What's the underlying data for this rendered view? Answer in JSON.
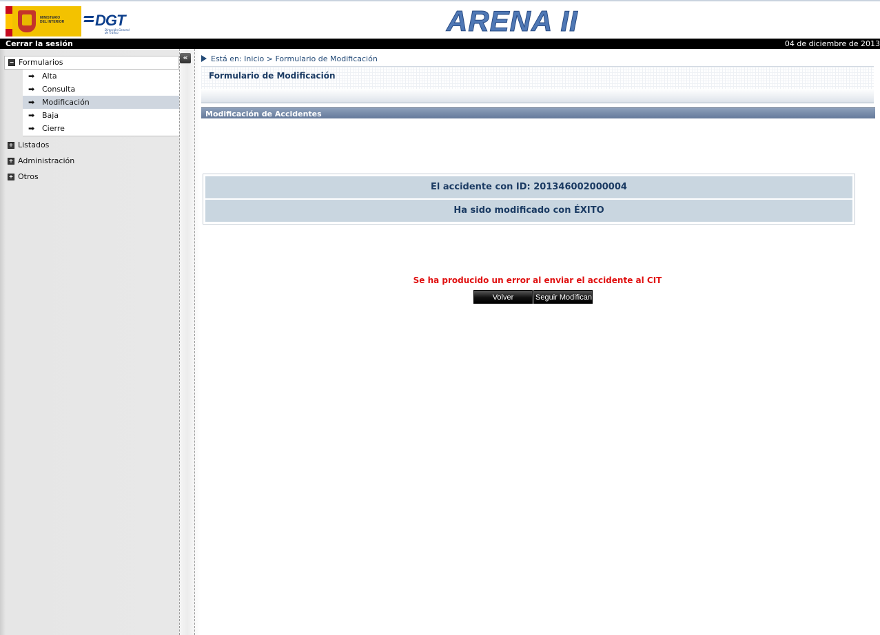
{
  "header": {
    "ministry_text": [
      "MINISTERIO",
      "DEL INTERIOR"
    ],
    "dgt_name": "DGT",
    "dgt_subtitle": [
      "Dirección General",
      "de Tráfico"
    ],
    "app_title": "ARENA II"
  },
  "topbar": {
    "logout_label": "Cerrar la sesión",
    "date": "04 de diciembre de 2013"
  },
  "sidebar": {
    "sections": [
      {
        "label": "Formularios",
        "expanded": true,
        "icon": "collapse-box-icon"
      },
      {
        "label": "Listados",
        "expanded": false,
        "icon": "expand-box-icon"
      },
      {
        "label": "Administración",
        "expanded": false,
        "icon": "expand-box-icon"
      },
      {
        "label": "Otros",
        "expanded": false,
        "icon": "expand-box-icon"
      }
    ],
    "items": [
      {
        "label": "Alta"
      },
      {
        "label": "Consulta"
      },
      {
        "label": "Modificación",
        "active": true
      },
      {
        "label": "Baja"
      },
      {
        "label": "Cierre"
      }
    ],
    "collapse_glyph": "«"
  },
  "main": {
    "breadcrumb": "Está en: Inicio > Formulario de Modificación",
    "form_title": "Formulario de Modificación",
    "section_title": "Modificación de Accidentes",
    "result_line1": "El accidente con ID: 201346002000004",
    "result_line2": "Ha sido modificado con ÉXITO",
    "error_message": "Se ha producido un error al enviar el accidente al CIT",
    "buttons": {
      "back": "Volver",
      "continue": "Seguir Modificando"
    }
  },
  "colors": {
    "accent": "#234a77",
    "section_bar": "#6f84a3",
    "result_bg": "#c9d6e0",
    "error": "#e01010",
    "title": "#4f78b5"
  }
}
